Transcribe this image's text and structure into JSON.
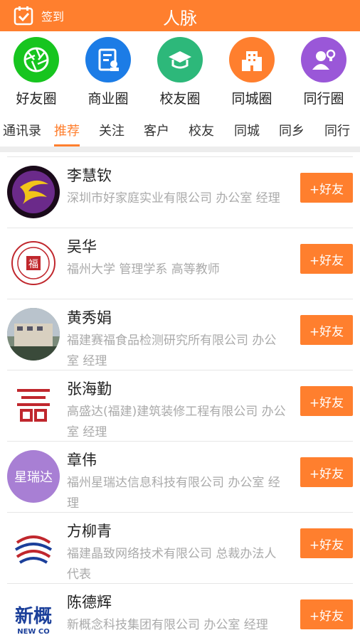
{
  "header": {
    "checkin_label": "签到",
    "title": "人脉"
  },
  "circles": [
    {
      "label": "好友圈",
      "color": "#17c51f",
      "icon": "aperture-icon"
    },
    {
      "label": "商业圈",
      "color": "#1c7ce6",
      "icon": "business-card-icon"
    },
    {
      "label": "校友圈",
      "color": "#2db87a",
      "icon": "graduation-cap-icon"
    },
    {
      "label": "同城圈",
      "color": "#ff7f2e",
      "icon": "building-icon"
    },
    {
      "label": "同行圈",
      "color": "#9a57d8",
      "icon": "people-idea-icon"
    }
  ],
  "tabs": [
    "通讯录",
    "推荐",
    "关注",
    "客户",
    "校友",
    "同城",
    "同乡",
    "同行"
  ],
  "active_tab": "推荐",
  "contacts": [
    {
      "name": "李慧钦",
      "desc": "深圳市好家庭实业有限公司 办公室 经理",
      "button": "+好友"
    },
    {
      "name": "吴华",
      "desc": "福州大学 管理学系 高等教师",
      "button": "+好友"
    },
    {
      "name": "黄秀娟",
      "desc": "福建赛福食品检测研究所有限公司 办公室 经理",
      "button": "+好友"
    },
    {
      "name": "张海勤",
      "desc": "高盛达(福建)建筑装修工程有限公司 办公室 经理",
      "button": "+好友"
    },
    {
      "name": "章伟",
      "desc": "福州星瑞达信息科技有限公司 办公室 经理",
      "button": "+好友",
      "avatar_text": "星瑞达"
    },
    {
      "name": "方柳青",
      "desc": "福建晶致网络技术有限公司 总裁办法人代表",
      "button": "+好友"
    },
    {
      "name": "陈德辉",
      "desc": "新概念科技集团有限公司 办公室 经理",
      "button": "+好友",
      "avatar_text": "新概",
      "avatar_subtext": "NEW CO"
    }
  ],
  "colors": {
    "accent": "#ff7f2e",
    "text_gray": "#aaaaaa"
  }
}
